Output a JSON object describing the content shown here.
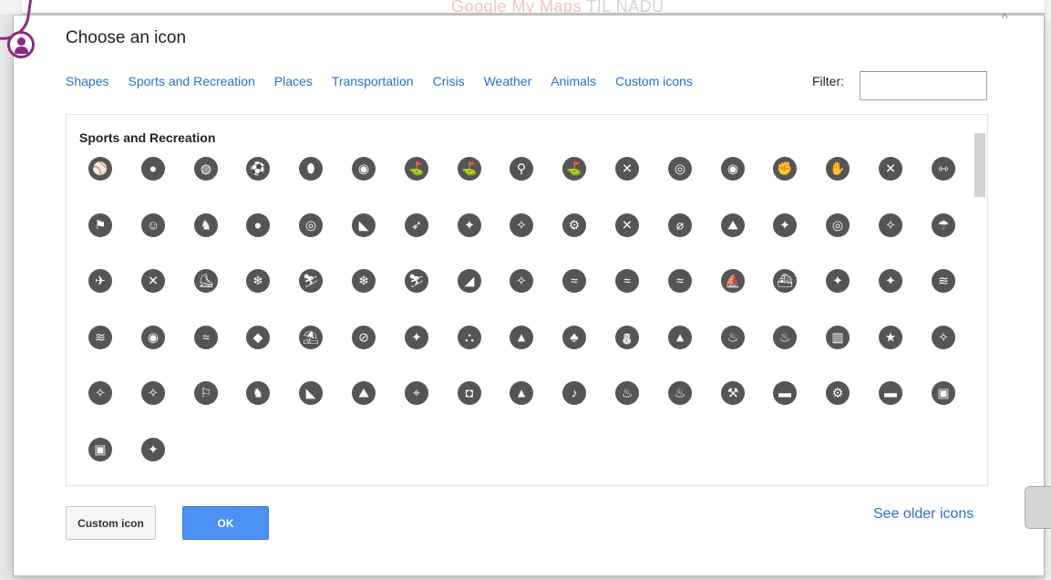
{
  "background": {
    "brand_text": "Google My Maps",
    "brand_suffix": "TIL NADU"
  },
  "dialog": {
    "title": "Choose an icon",
    "collapse_glyph": "^",
    "tabs": [
      "Shapes",
      "Sports and Recreation",
      "Places",
      "Transportation",
      "Crisis",
      "Weather",
      "Animals",
      "Custom icons"
    ],
    "filter_label": "Filter:",
    "filter_value": "",
    "section_heading": "Sports and Recreation",
    "icons": [
      {
        "name": "baseball-icon",
        "glyph": "⚾"
      },
      {
        "name": "basketball-icon",
        "glyph": "●"
      },
      {
        "name": "football-icon",
        "glyph": "◍"
      },
      {
        "name": "soccer-player-icon",
        "glyph": "⚽"
      },
      {
        "name": "rugby-icon",
        "glyph": "⬮"
      },
      {
        "name": "volleyball-icon",
        "glyph": "◉"
      },
      {
        "name": "golfer-icon",
        "glyph": "⛳"
      },
      {
        "name": "golf-icon",
        "glyph": "⛳"
      },
      {
        "name": "magnifier-icon",
        "glyph": "⚲"
      },
      {
        "name": "golf-tee-icon",
        "glyph": "⛳"
      },
      {
        "name": "badminton-icon",
        "glyph": "✕"
      },
      {
        "name": "tennis-racket-icon",
        "glyph": "◎"
      },
      {
        "name": "racket-icon",
        "glyph": "◉"
      },
      {
        "name": "boxing-glove-icon",
        "glyph": "✊"
      },
      {
        "name": "martial-arts-icon",
        "glyph": "✋"
      },
      {
        "name": "fencing-icon",
        "glyph": "✕"
      },
      {
        "name": "weightlifting-icon",
        "glyph": "⇿"
      },
      {
        "name": "checkered-flag-icon",
        "glyph": "⚑"
      },
      {
        "name": "waterpolo-icon",
        "glyph": "☺"
      },
      {
        "name": "horse-racing-icon",
        "glyph": "♞"
      },
      {
        "name": "bowling-icon",
        "glyph": "●"
      },
      {
        "name": "target-icon",
        "glyph": "◎"
      },
      {
        "name": "hockey-puck-icon",
        "glyph": "◣"
      },
      {
        "name": "archery-icon",
        "glyph": "➶"
      },
      {
        "name": "running-icon",
        "glyph": "✦"
      },
      {
        "name": "hiking-icon",
        "glyph": "✧"
      },
      {
        "name": "cycling-icon",
        "glyph": "⚙"
      },
      {
        "name": "dancing-icon",
        "glyph": "✕"
      },
      {
        "name": "climbing-rope-icon",
        "glyph": "⌀"
      },
      {
        "name": "rock-climbing-icon",
        "glyph": "⛰"
      },
      {
        "name": "gymnast-icon",
        "glyph": "✦"
      },
      {
        "name": "ice-rink-icon",
        "glyph": "◎"
      },
      {
        "name": "skating-icon",
        "glyph": "✧"
      },
      {
        "name": "parachute-icon",
        "glyph": "☂"
      },
      {
        "name": "hang-gliding-icon",
        "glyph": "✈"
      },
      {
        "name": "ice-hockey-icon",
        "glyph": "✕"
      },
      {
        "name": "ice-skate-icon",
        "glyph": "⛸"
      },
      {
        "name": "snowboarding-icon",
        "glyph": "❄"
      },
      {
        "name": "skiing-icon",
        "glyph": "⛷"
      },
      {
        "name": "ski-lift-icon",
        "glyph": "❄"
      },
      {
        "name": "cross-country-ski-icon",
        "glyph": "⛷"
      },
      {
        "name": "sledding-icon",
        "glyph": "◢"
      },
      {
        "name": "snowshoe-icon",
        "glyph": "✧"
      },
      {
        "name": "jet-ski-icon",
        "glyph": "≈"
      },
      {
        "name": "rowing-icon",
        "glyph": "≈"
      },
      {
        "name": "kayak-icon",
        "glyph": "≈"
      },
      {
        "name": "sailing-icon",
        "glyph": "⛵"
      },
      {
        "name": "motorboat-icon",
        "glyph": "⛴"
      },
      {
        "name": "water-ski-icon",
        "glyph": "✦"
      },
      {
        "name": "kite-surf-icon",
        "glyph": "✦"
      },
      {
        "name": "surfing-icon",
        "glyph": "≋"
      },
      {
        "name": "swimming-icon",
        "glyph": "≋"
      },
      {
        "name": "snorkel-icon",
        "glyph": "◉"
      },
      {
        "name": "diving-icon",
        "glyph": "≈"
      },
      {
        "name": "fishing-icon",
        "glyph": "◆"
      },
      {
        "name": "beach-icon",
        "glyph": "⛱"
      },
      {
        "name": "no-fishing-icon",
        "glyph": "⊘"
      },
      {
        "name": "frisbee-icon",
        "glyph": "✦"
      },
      {
        "name": "picnic-icon",
        "glyph": "⛬"
      },
      {
        "name": "pine-tree-icon",
        "glyph": "▲"
      },
      {
        "name": "tree-icon",
        "glyph": "♣"
      },
      {
        "name": "palm-tree-icon",
        "glyph": "⛄"
      },
      {
        "name": "mountain-icon",
        "glyph": "▲"
      },
      {
        "name": "campfire-icon",
        "glyph": "♨"
      },
      {
        "name": "hot-spring-icon",
        "glyph": "♨"
      },
      {
        "name": "waterfall-icon",
        "glyph": "▥"
      },
      {
        "name": "star-icon",
        "glyph": "★"
      },
      {
        "name": "nordic-walking-icon",
        "glyph": "✧"
      },
      {
        "name": "hiker-icon",
        "glyph": "✧"
      },
      {
        "name": "family-hiking-icon",
        "glyph": "✧"
      },
      {
        "name": "vista-icon",
        "glyph": "⚐"
      },
      {
        "name": "deer-icon",
        "glyph": "♞"
      },
      {
        "name": "bird-icon",
        "glyph": "◣"
      },
      {
        "name": "climbing-icon",
        "glyph": "⛰"
      },
      {
        "name": "telescope-icon",
        "glyph": "⌖"
      },
      {
        "name": "binoculars-icon",
        "glyph": "◘"
      },
      {
        "name": "tent-icon",
        "glyph": "▲"
      },
      {
        "name": "guitar-icon",
        "glyph": "♪"
      },
      {
        "name": "fire-pit-icon",
        "glyph": "♨"
      },
      {
        "name": "grill-icon",
        "glyph": "♨"
      },
      {
        "name": "axe-icon",
        "glyph": "⚒"
      },
      {
        "name": "rv-icon",
        "glyph": "▬"
      },
      {
        "name": "motorcycle-icon",
        "glyph": "⚙"
      },
      {
        "name": "camper-van-icon",
        "glyph": "▬"
      },
      {
        "name": "camper-icon",
        "glyph": "▣"
      },
      {
        "name": "cinema-icon",
        "glyph": "▣"
      },
      {
        "name": "trophy-icon",
        "glyph": "✦"
      }
    ],
    "custom_icon_button": "Custom icon",
    "ok_button": "OK",
    "older_icons_link": "See older icons"
  },
  "colors": {
    "link": "#2f6fc9",
    "ok_button": "#4d90f2",
    "icon_fill": "#555555",
    "avatar_accent": "#8a2a86"
  }
}
